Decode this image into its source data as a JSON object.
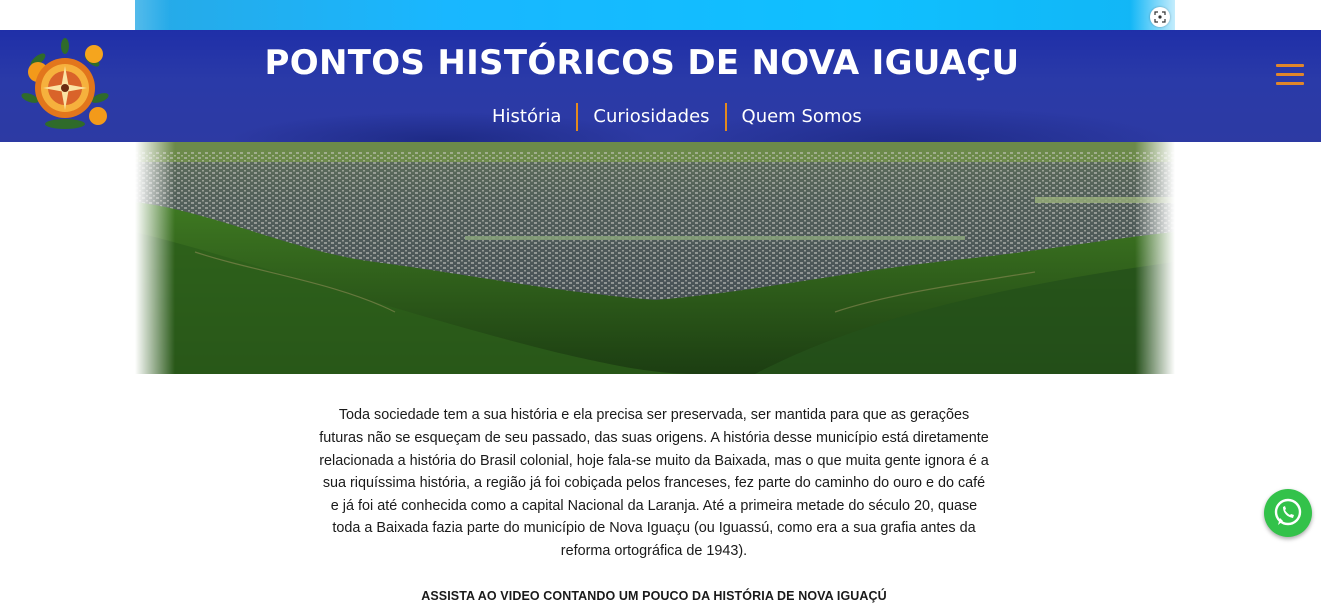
{
  "header": {
    "title": "PONTOS HISTÓRICOS DE NOVA IGUAÇU",
    "nav": [
      {
        "label": "História"
      },
      {
        "label": "Curiosidades"
      },
      {
        "label": "Quem Somos"
      }
    ],
    "menu_icon": "hamburger-icon",
    "logo_icon": "orange-logo"
  },
  "hero": {
    "image_icon": "city-aerial-view"
  },
  "content": {
    "intro": "Toda sociedade tem a sua história e ela precisa ser preservada, ser mantida para que as gerações futuras não se esqueçam de seu passado, das suas origens. A história desse município está diretamente relacionada a história do Brasil colonial, hoje fala-se muito da Baixada, mas o que muita gente ignora é a sua riquíssima história, a região já foi cobiçada pelos franceses, fez parte do caminho do ouro e do café e já foi até conhecida como a capital Nacional da Laranja. Até a primeira metade do século 20, quase toda a Baixada fazia parte do município de Nova Iguaçu (ou Iguassú, como era a sua grafia antes da reforma ortográfica de 1943).",
    "video_heading": "ASSISTA AO VIDEO CONTANDO UM POUCO DA HISTÓRIA DE NOVA IGUAÇÚ"
  },
  "floating": {
    "whatsapp_icon": "whatsapp-icon",
    "lens_icon": "lens-icon"
  },
  "colors": {
    "header_bg": "#2d3aa3",
    "accent": "#e38a1e",
    "whatsapp": "#33c24a"
  }
}
